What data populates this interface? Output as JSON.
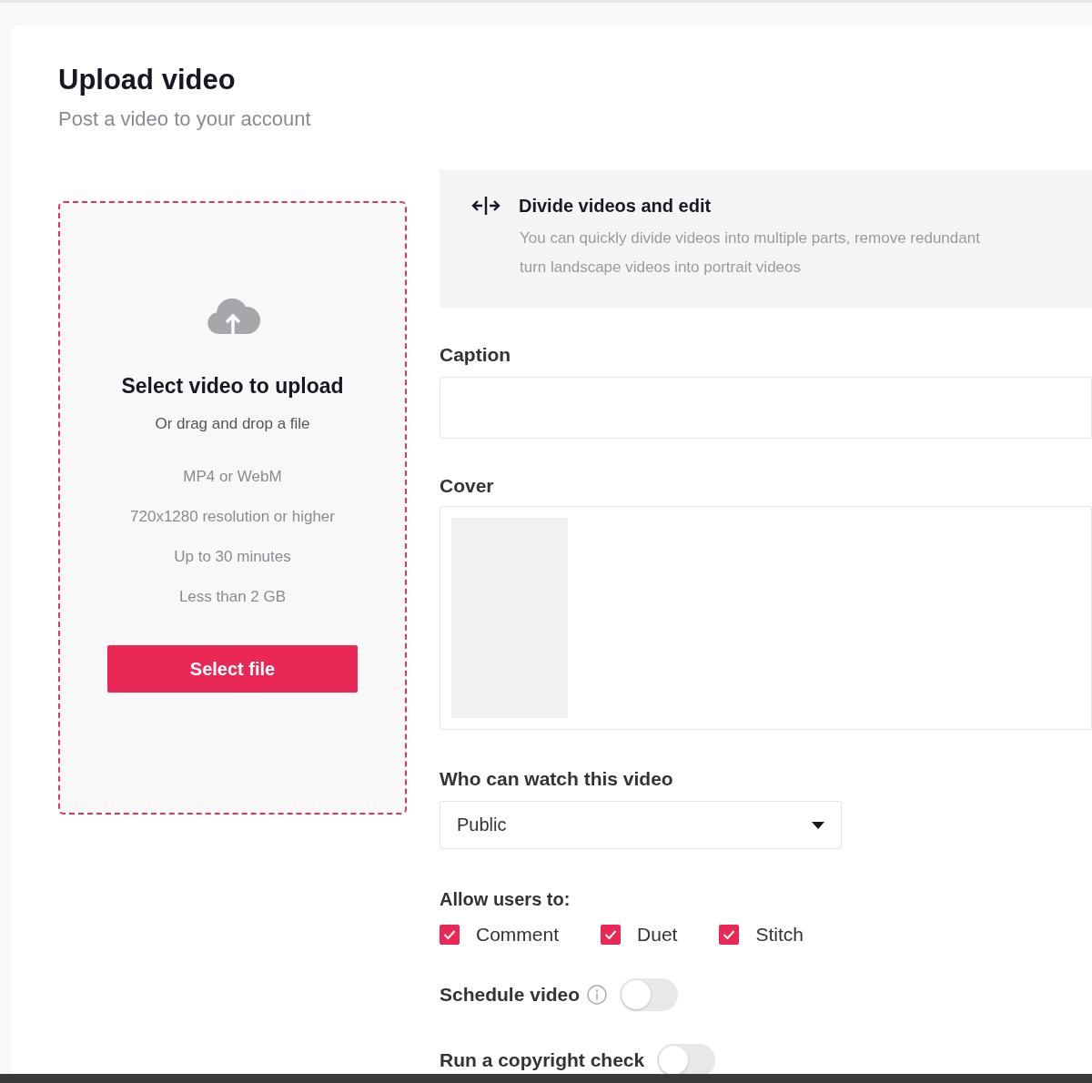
{
  "header": {
    "title": "Upload video",
    "subtitle": "Post a video to your account"
  },
  "upload": {
    "title": "Select video to upload",
    "hint": "Or drag and drop a file",
    "requirements": [
      "MP4 or WebM",
      "720x1280 resolution or higher",
      "Up to 30 minutes",
      "Less than 2 GB"
    ],
    "button": "Select file"
  },
  "tip": {
    "title": "Divide videos and edit",
    "lines": [
      "You can quickly divide videos into multiple parts, remove redundant",
      "turn landscape videos into portrait videos"
    ]
  },
  "caption": {
    "label": "Caption"
  },
  "cover": {
    "label": "Cover"
  },
  "visibility": {
    "label": "Who can watch this video",
    "value": "Public"
  },
  "permissions": {
    "label": "Allow users to:",
    "options": [
      {
        "label": "Comment",
        "checked": true
      },
      {
        "label": "Duet",
        "checked": true
      },
      {
        "label": "Stitch",
        "checked": true
      }
    ]
  },
  "toggles": [
    {
      "label": "Schedule video",
      "info": true,
      "on": false
    },
    {
      "label": "Run a copyright check",
      "info": false,
      "on": false
    }
  ]
}
